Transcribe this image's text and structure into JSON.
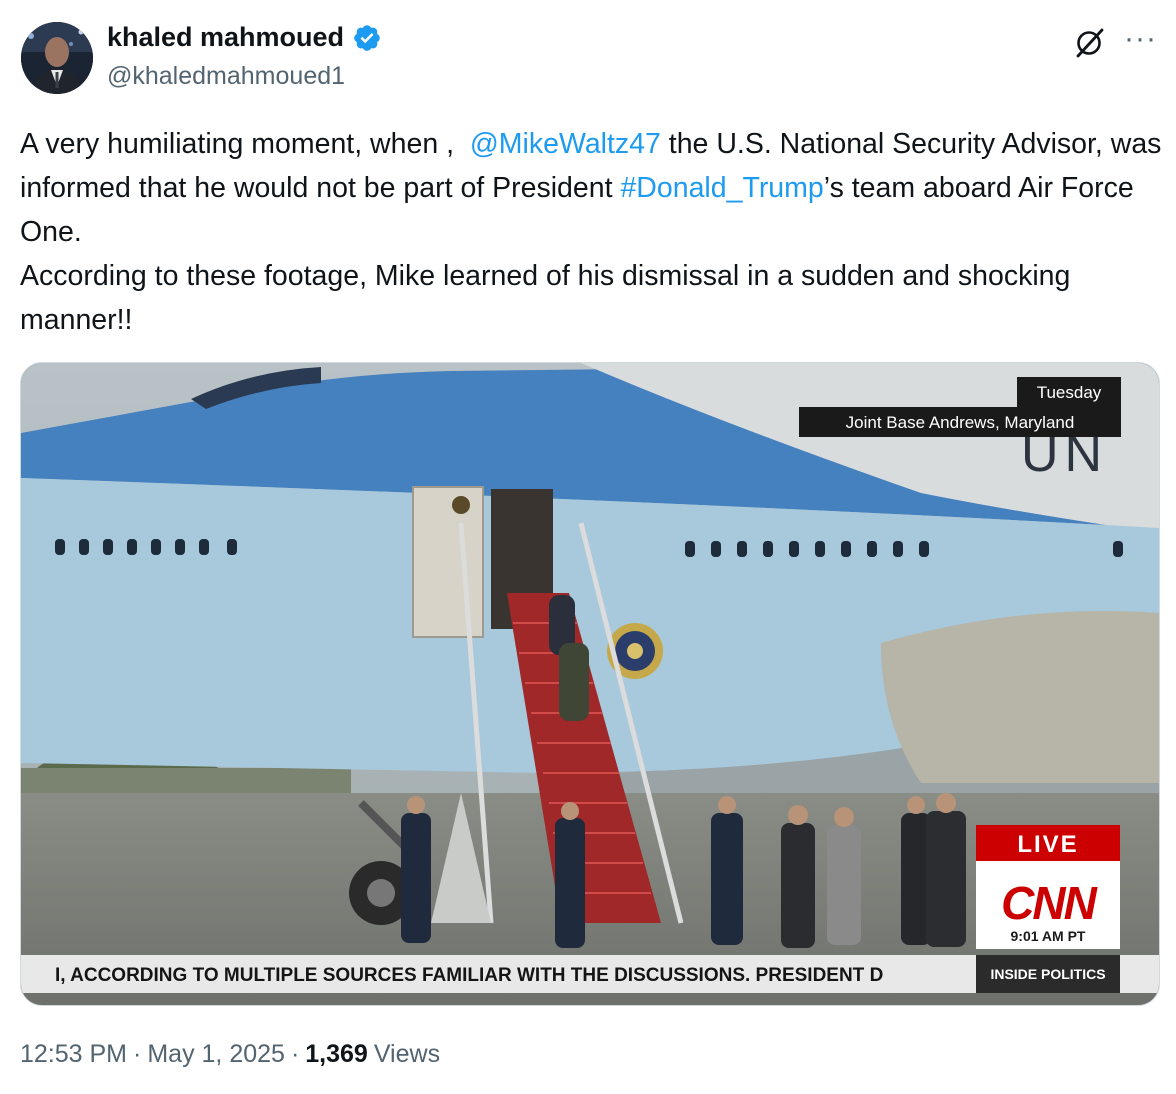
{
  "author": {
    "display_name": "khaled mahmoued",
    "handle": "@khaledmahmoued1",
    "verified_icon": "verified-badge-icon",
    "verified_color": "#1d9bf0"
  },
  "actions": {
    "grok_icon": "grok-icon",
    "more_label": "···"
  },
  "tweet": {
    "part1": "A very humiliating moment, when ,  ",
    "mention": "@MikeWaltz47",
    "part2": " the U.S. National Security Advisor, was informed that he would not be part of President ",
    "hashtag": "#Donald_Trump",
    "part3": "’s team aboard Air Force One.\nAccording to these footage, Mike learned of his dismissal in a sudden and shocking manner!!"
  },
  "media": {
    "day_label": "Tuesday",
    "location_label": "Joint Base Andrews, Maryland",
    "plane_lettering": "UN",
    "live_label": "LIVE",
    "network_logo": "CNN",
    "time_label": "9:01 AM PT",
    "ticker_text": "I, ACCORDING TO MULTIPLE SOURCES FAMILIAR WITH THE DISCUSSIONS. PRESIDENT D",
    "program_label": "INSIDE POLITICS"
  },
  "footer": {
    "time": "12:53 PM",
    "sep1": "·",
    "date": "May 1, 2025",
    "sep2": "·",
    "views_count": "1,369",
    "views_label": "Views"
  },
  "colors": {
    "link": "#1d9bf0",
    "secondary_text": "#536471",
    "cnn_red": "#cc0000",
    "plane_blue": "#3e7fc4",
    "plane_light": "#a9cbe0"
  }
}
